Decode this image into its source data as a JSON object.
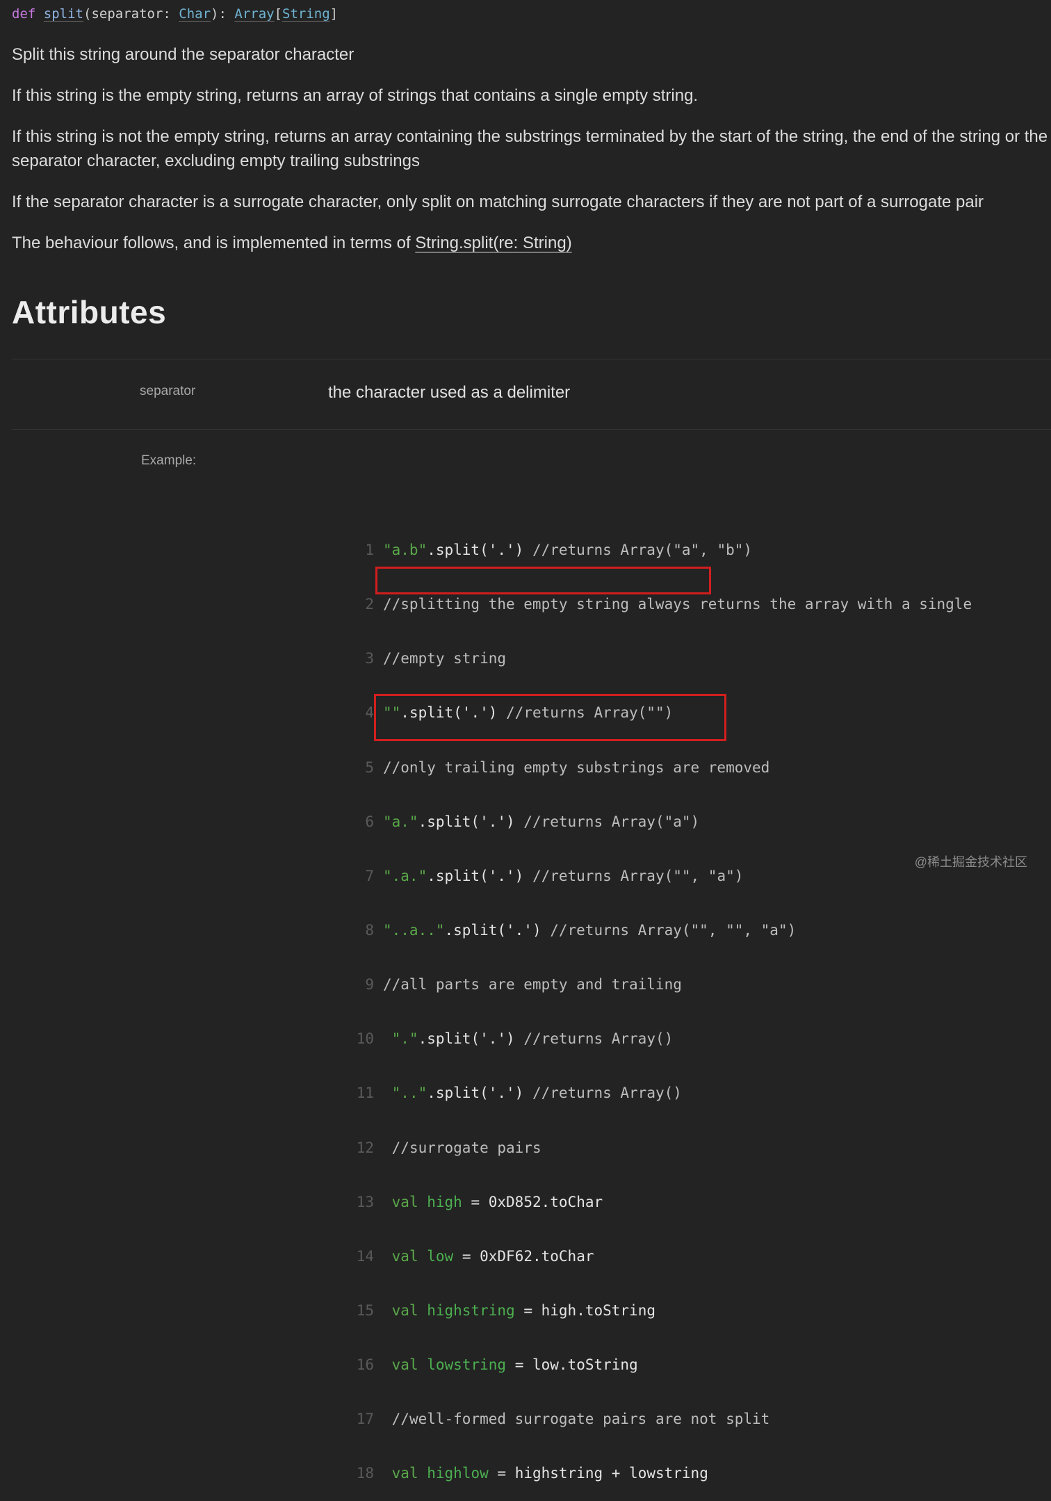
{
  "signature": {
    "def": "def",
    "name": "split",
    "open_paren": "(",
    "param": "separator",
    "colon": ": ",
    "param_type": "Char",
    "close_paren": "): ",
    "return_type": "Array",
    "bracket_open": "[",
    "return_inner": "String",
    "bracket_close": "]"
  },
  "paragraphs": [
    "Split this string around the separator character",
    "If this string is the empty string, returns an array of strings that contains a single empty string.",
    "If this string is not the empty string, returns an array containing the substrings terminated by the start of the string, the end of the string or the separator character, excluding empty trailing substrings",
    "If the separator character is a surrogate character, only split on matching surrogate characters if they are not part of a surrogate pair"
  ],
  "behaviour": {
    "prefix": "The behaviour follows, and is implemented in terms of ",
    "link": "String.split(re: String)"
  },
  "heading": "Attributes",
  "attributes": {
    "param_name": "separator",
    "param_desc": "the character used as a delimiter",
    "example_label": "Example:"
  },
  "code": {
    "line_numbers": [
      "1",
      "2",
      "3",
      "4",
      "5",
      "6",
      "7",
      "8",
      "9",
      "10",
      "11",
      "12",
      "13",
      "14",
      "15",
      "16",
      "17",
      "18"
    ],
    "l1": {
      "s": "\"a.b\"",
      "rest": ".split('.') ",
      "cm": "//returns Array(\"a\", \"b\")"
    },
    "l2": {
      "cm": "//splitting the empty string always returns the array with a single"
    },
    "l3": {
      "cm": "//empty string"
    },
    "l4": {
      "s": "\"\"",
      "rest": ".split('.') ",
      "cm": "//returns Array(\"\")"
    },
    "l5": {
      "cm": "//only trailing empty substrings are removed"
    },
    "l6": {
      "s": "\"a.\"",
      "rest": ".split('.') ",
      "cm": "//returns Array(\"a\")"
    },
    "l7": {
      "s": "\".a.\"",
      "rest": ".split('.') ",
      "cm": "//returns Array(\"\", \"a\")"
    },
    "l8": {
      "s": "\"..a..\"",
      "rest": ".split('.') ",
      "cm": "//returns Array(\"\", \"\", \"a\")"
    },
    "l9": {
      "cm": "//all parts are empty and trailing"
    },
    "l10": {
      "s": "\".\"",
      "rest": ".split('.') ",
      "cm": "//returns Array()"
    },
    "l11": {
      "s": "\"..\"",
      "rest": ".split('.') ",
      "cm": "//returns Array()"
    },
    "l12": {
      "cm": "//surrogate pairs"
    },
    "l13": {
      "kw": "val",
      "id": "high",
      "rest": " = 0xD852.toChar"
    },
    "l14": {
      "kw": "val",
      "id": "low",
      "rest": " = 0xDF62.toChar"
    },
    "l15": {
      "kw": "val",
      "id": "highstring",
      "rest": " = high.toString"
    },
    "l16": {
      "kw": "val",
      "id": "lowstring",
      "rest": " = low.toString"
    },
    "l17": {
      "cm": "//well-formed surrogate pairs are not split"
    },
    "l18": {
      "kw": "val",
      "id": "highlow",
      "rest": " = highstring + lowstring"
    }
  },
  "watermark": "@稀土掘金技术社区",
  "colors": {
    "background": "#232323",
    "keyword": "#c678dd",
    "string": "#5aa84a",
    "highlight_box": "#d21e1e"
  }
}
